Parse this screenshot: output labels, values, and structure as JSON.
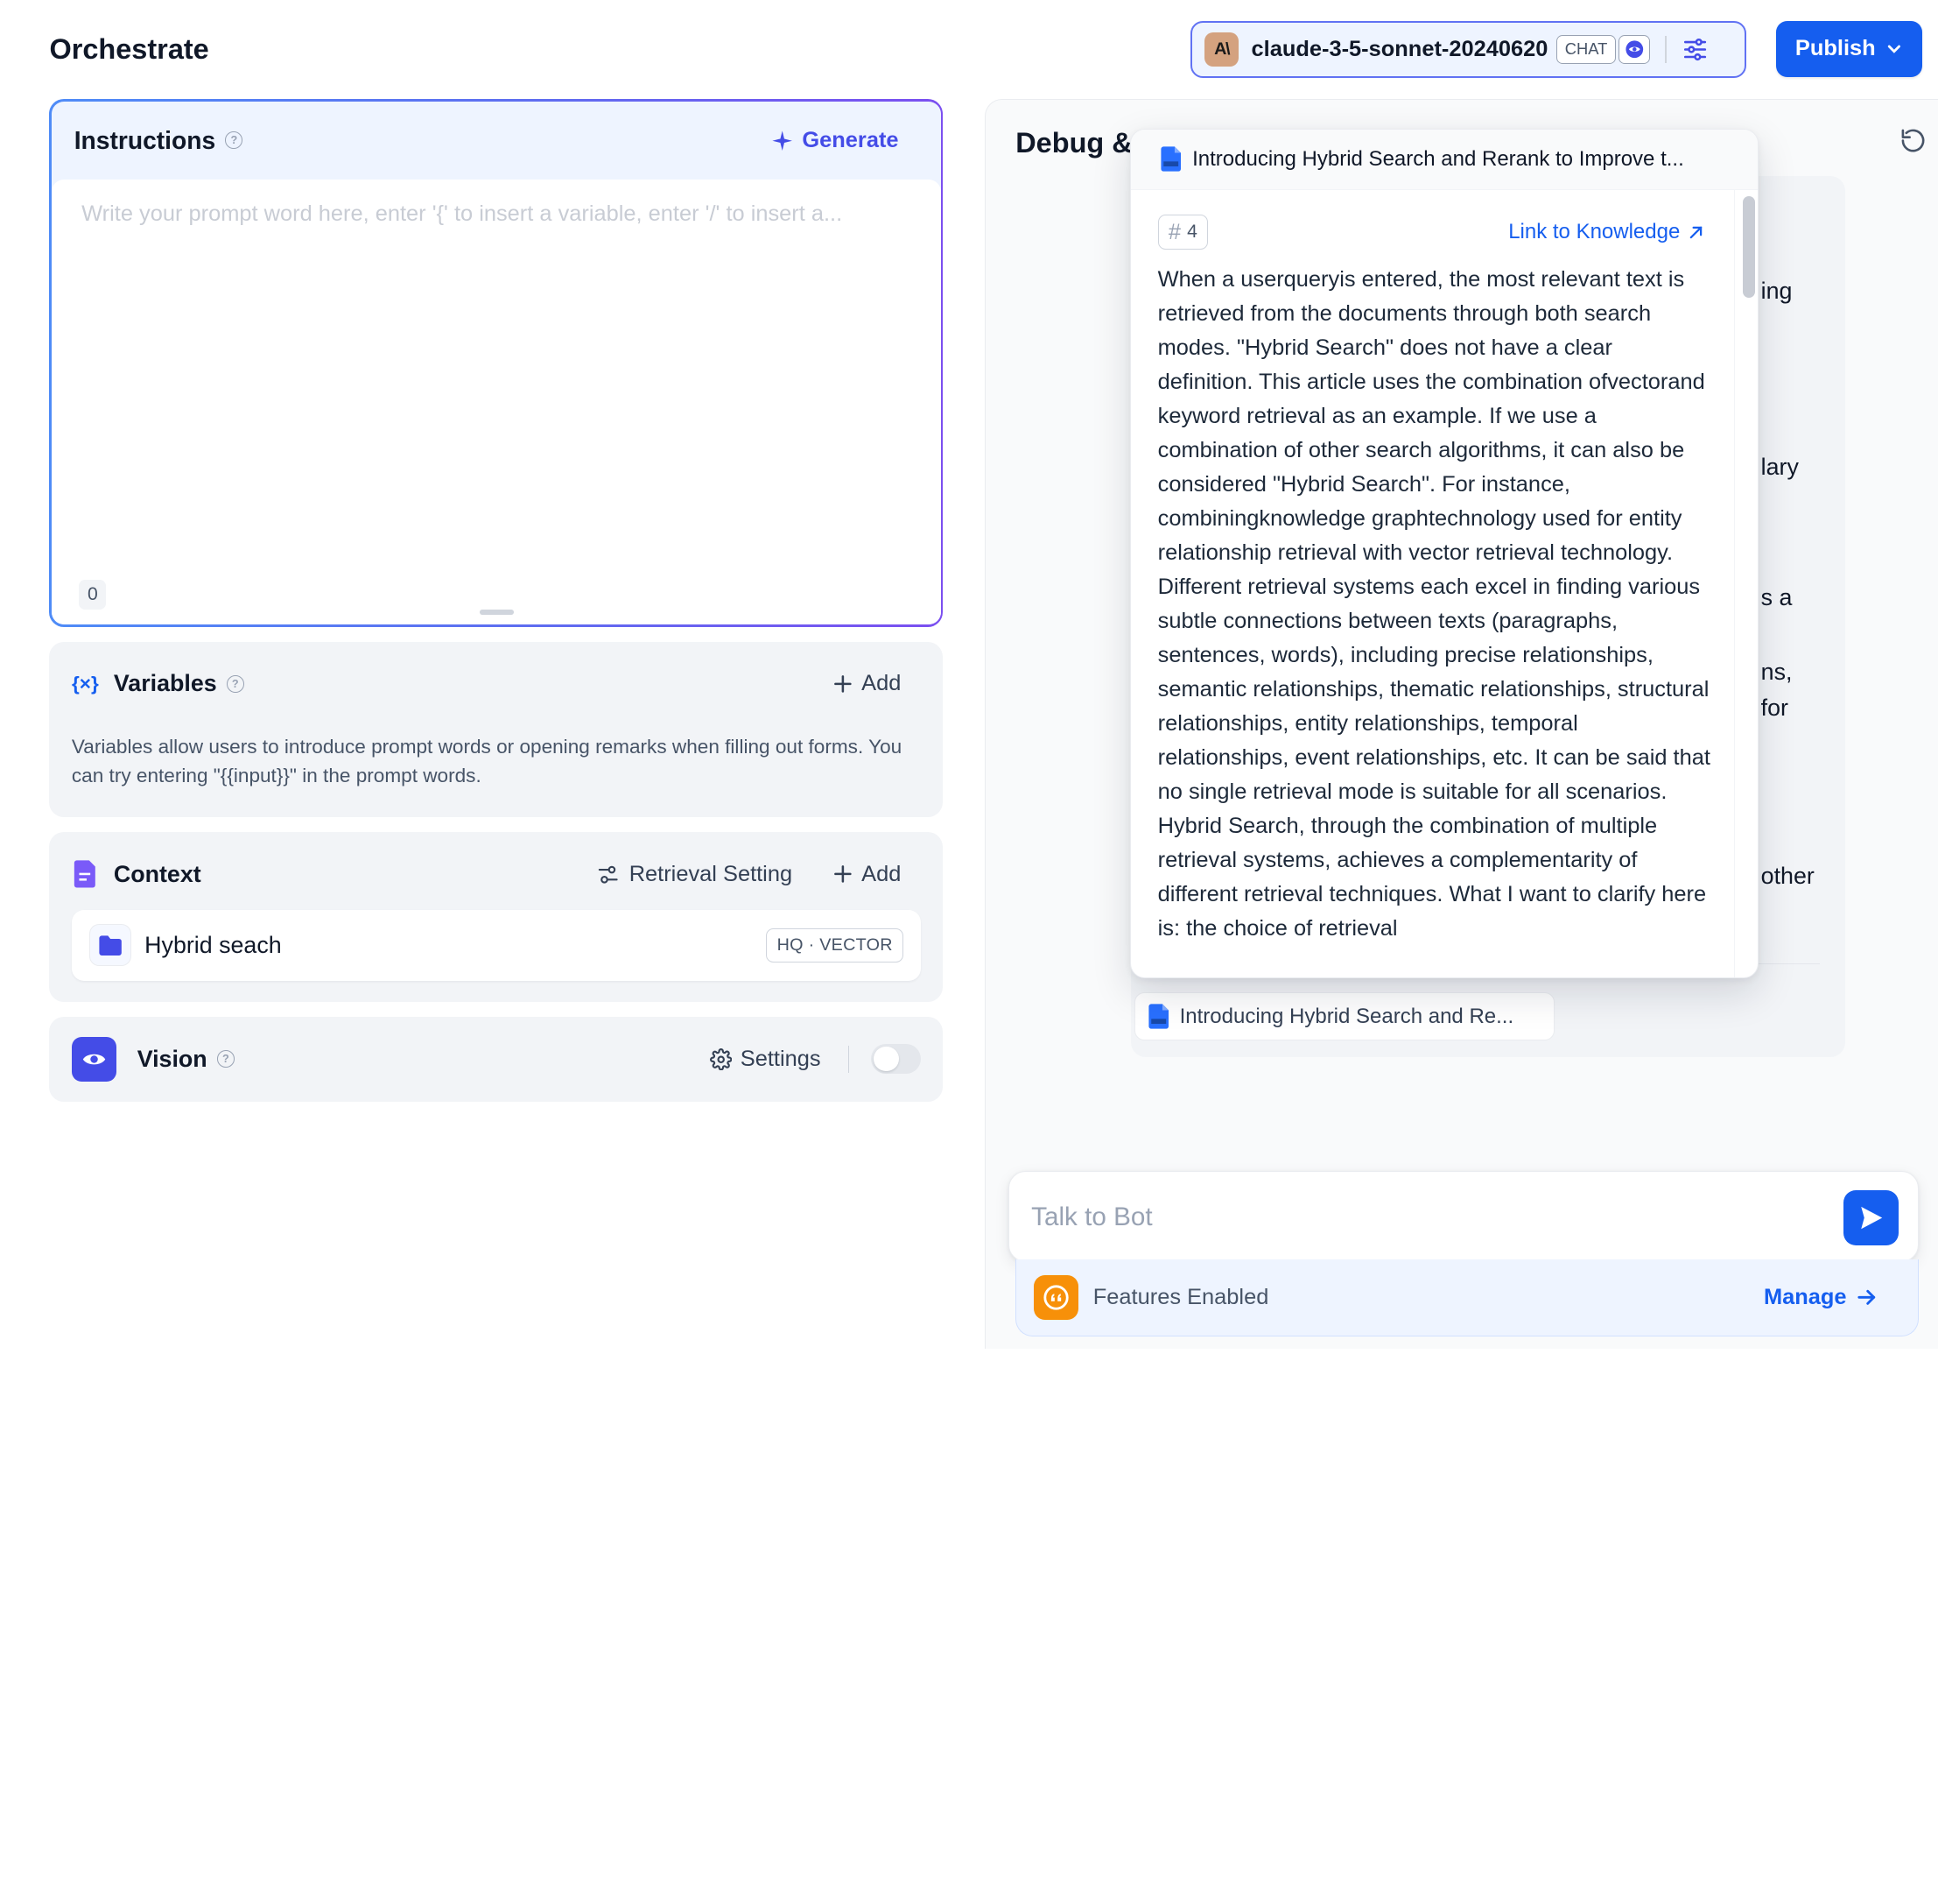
{
  "header": {
    "title": "Orchestrate",
    "model": {
      "logo_text": "A\\",
      "name": "claude-3-5-sonnet-20240620",
      "mode_badge": "CHAT"
    },
    "publish_label": "Publish"
  },
  "instructions": {
    "title": "Instructions",
    "generate_label": "Generate",
    "placeholder": "Write your prompt word here, enter '{' to insert a variable, enter '/' to insert a...",
    "char_count": "0"
  },
  "variables": {
    "icon_text": "{×}",
    "title": "Variables",
    "add_label": "Add",
    "description": "Variables allow users to introduce prompt words or opening remarks when filling out forms. You can try entering \"{{input}}\" in the prompt words."
  },
  "context": {
    "title": "Context",
    "retrieval_label": "Retrieval Setting",
    "add_label": "Add",
    "dataset": {
      "name": "Hybrid seach",
      "tag": "HQ · VECTOR"
    }
  },
  "vision": {
    "title": "Vision",
    "settings_label": "Settings",
    "enabled": false
  },
  "debug": {
    "title": "Debug &",
    "peek_lines": [
      "ing",
      "lary",
      "s a",
      "ns,",
      "for",
      "other"
    ],
    "citation_chip": "Introducing Hybrid Search and Re...",
    "input_placeholder": "Talk to Bot",
    "features_label": "Features Enabled",
    "manage_label": "Manage"
  },
  "popover": {
    "doc_title": "Introducing Hybrid Search and Rerank to Improve t...",
    "segment_number": "4",
    "link_label": "Link to Knowledge",
    "content": "When a userqueryis entered, the most relevant text is retrieved from the documents through both search modes. \"Hybrid Search\" does not have a clear definition. This article uses the combination ofvectorand keyword retrieval as an example. If we use a combination of other search algorithms, it can also be considered \"Hybrid Search\". For instance, combiningknowledge graphtechnology used for entity relationship retrieval with vector retrieval technology. Different retrieval systems each excel in finding various subtle connections between texts (paragraphs, sentences, words), including precise relationships, semantic relationships, thematic relationships, structural relationships, entity relationships, temporal relationships, event relationships, etc. It can be said that no single retrieval mode is suitable for all scenarios. Hybrid Search, through the combination of multiple retrieval systems, achieves a complementarity of different retrieval techniques. What I want to clarify here is: the choice of retrieval"
  },
  "colors": {
    "primary": "#155eef",
    "accent_indigo": "#444ce7",
    "vision_bg": "#444ce7",
    "features_icon_bg": "#f79009",
    "model_logo_bg": "#d4a27f"
  }
}
